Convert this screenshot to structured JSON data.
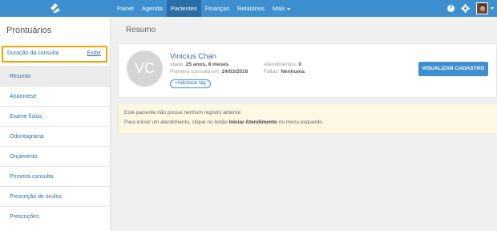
{
  "colors": {
    "brand": "#3d8fcf",
    "nav_active": "#2a6ea8",
    "highlight_border": "#f0a400",
    "alert_bg": "#fcf8e3"
  },
  "nav": {
    "items": [
      "Painel",
      "Agenda",
      "Pacientes",
      "Finanças",
      "Relatórios"
    ],
    "more": "Mais",
    "active": "Pacientes"
  },
  "sidebar": {
    "title": "Prontuários",
    "duracao": {
      "label": "Duração da consulta",
      "link": "Exibir"
    },
    "items": [
      "Resumo",
      "Anamnese",
      "Exame físico",
      "Odontograma",
      "Orçamento",
      "Primeira consulta",
      "Prescrição de óculos",
      "Prescrições"
    ],
    "active": "Resumo"
  },
  "main": {
    "title": "Resumo",
    "patient": {
      "initials": "VC",
      "name": "Vinicius Chan",
      "idade_label": "Idade:",
      "idade_value": "25 anos, 8 meses",
      "primeira_label": "Primeira consulta em:",
      "primeira_value": "24/03/2016",
      "atend_label": "Atendimentos:",
      "atend_value": "0",
      "faltas_label": "Faltas:",
      "faltas_value": "Nenhuma",
      "tag_button": "Adicionar tag",
      "cadastro_button": "VISUALIZAR CADASTRO"
    },
    "alert": {
      "line1": "Este paciente não possui nenhum registro anterior.",
      "line2_pre": "Para iniciar um atendimento, clique no botão",
      "line2_bold": "Iniciar Atendimento",
      "line2_post": "no menu esquerdo."
    }
  }
}
